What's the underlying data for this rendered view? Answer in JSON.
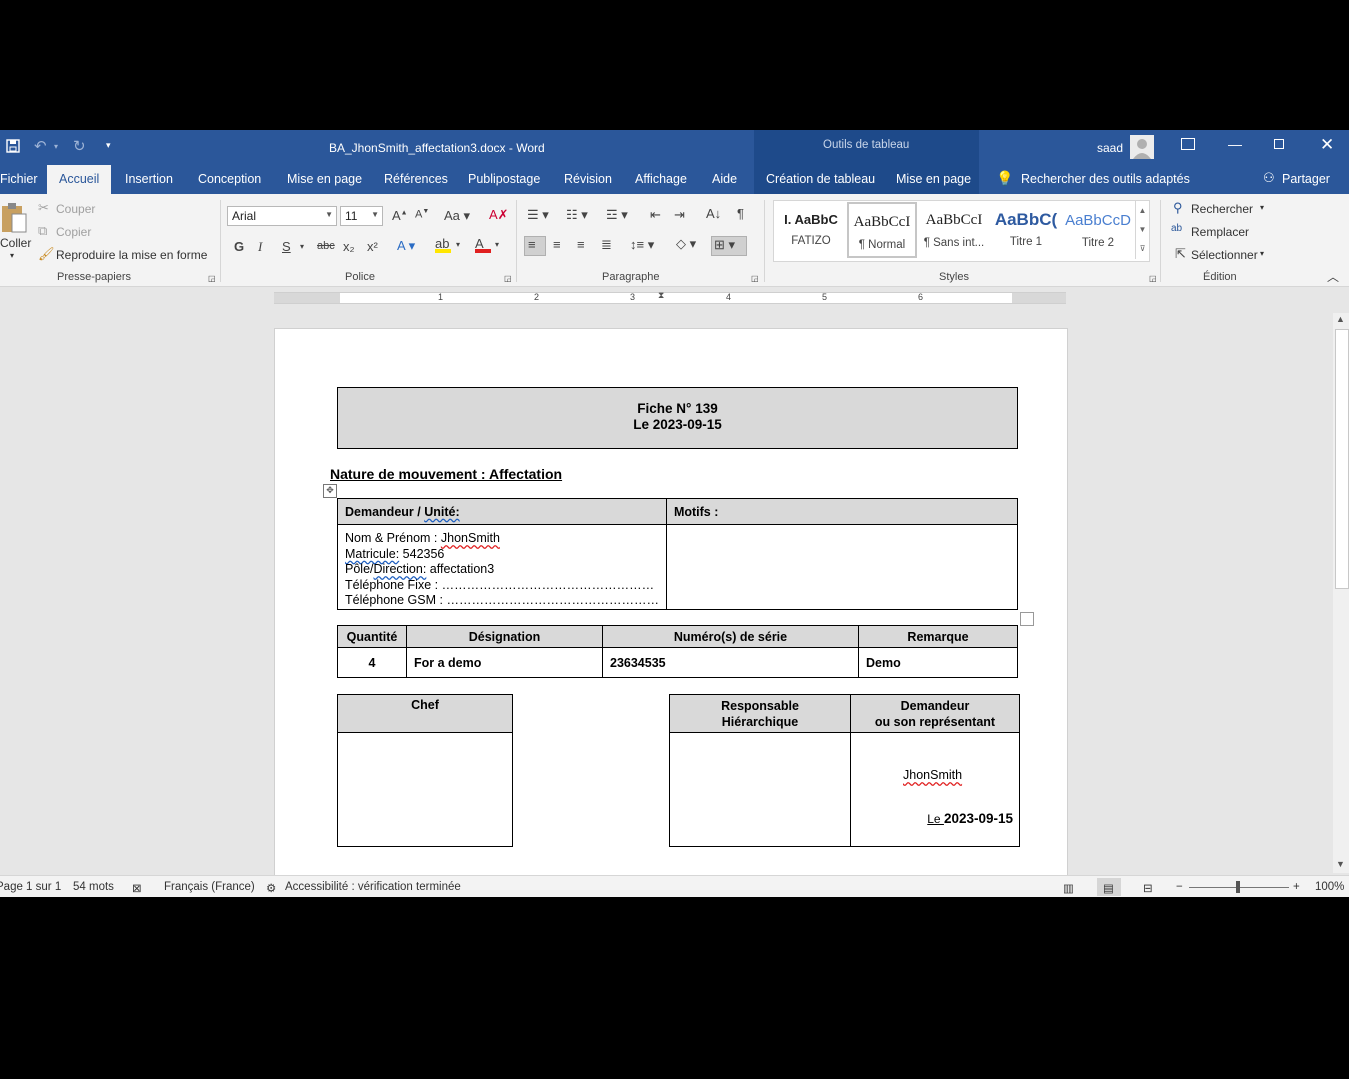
{
  "window": {
    "doc_title": "BA_JhonSmith_affectation3.docx  -  Word",
    "context_title": "Outils de tableau",
    "user": "saad"
  },
  "tabs": [
    "Fichier",
    "Accueil",
    "Insertion",
    "Conception",
    "Mise en page",
    "Références",
    "Publipostage",
    "Révision",
    "Affichage",
    "Aide",
    "Création de tableau",
    "Mise en page"
  ],
  "tell_me": "Rechercher des outils adaptés",
  "share": "Partager",
  "ribbon": {
    "clipboard": {
      "paste": "Coller",
      "cut": "Couper",
      "copy": "Copier",
      "format_painter": "Reproduire la mise en forme",
      "label": "Presse-papiers"
    },
    "font": {
      "name": "Arial",
      "size": "11",
      "label": "Police",
      "bold": "G",
      "italic": "I",
      "underline": "S",
      "strike": "abc",
      "sub": "x₂",
      "sup": "x²"
    },
    "paragraph": {
      "label": "Paragraphe"
    },
    "styles": {
      "label": "Styles",
      "items": [
        {
          "preview": "I.  AaBbC",
          "name": "FATIZO"
        },
        {
          "preview": "AaBbCcI",
          "name": "¶ Normal"
        },
        {
          "preview": "AaBbCcI",
          "name": "¶ Sans int..."
        },
        {
          "preview": "AaBbC(",
          "name": "Titre 1"
        },
        {
          "preview": "AaBbCcD",
          "name": "Titre 2"
        }
      ]
    },
    "editing": {
      "find": "Rechercher",
      "replace": "Remplacer",
      "select": "Sélectionner",
      "label": "Édition"
    }
  },
  "ruler_numbers": [
    "1",
    "2",
    "3",
    "4",
    "5",
    "6"
  ],
  "document": {
    "fiche": "Fiche N° 139",
    "date_line": "Le 2023-09-15",
    "nature": "Nature de mouvement : Affectation",
    "req_header": "Demandeur / Unité:",
    "motifs_header": "Motifs :",
    "req_lines": {
      "name_label": "Nom & Prénom : ",
      "name": "JhonSmith",
      "mat_label": "Matricule:",
      "mat": " 542356",
      "pole_a": "Pôle/",
      "pole_b": "Direction:",
      "pole_c": " affectation3",
      "tel_fixe": "Téléphone Fixe : ……………………………………………",
      "tel_gsm": "Téléphone GSM : ……………………………………………"
    },
    "items_table": {
      "headers": [
        "Quantité",
        "Désignation",
        "Numéro(s) de série",
        "Remarque"
      ],
      "row": [
        "4",
        "For a demo",
        "23634535",
        "Demo"
      ]
    },
    "sign": {
      "chef": "Chef",
      "resp_1": "Responsable",
      "resp_2": "Hiérarchique",
      "dem_1": "Demandeur",
      "dem_2": "ou son représentant",
      "dem_name": "JhonSmith",
      "le": "Le ",
      "date": "2023-09-15"
    }
  },
  "status": {
    "page": "Page 1 sur 1",
    "words": "54 mots",
    "language": "Français (France)",
    "accessibility": "Accessibilité : vérification terminée",
    "zoom": "100%"
  }
}
